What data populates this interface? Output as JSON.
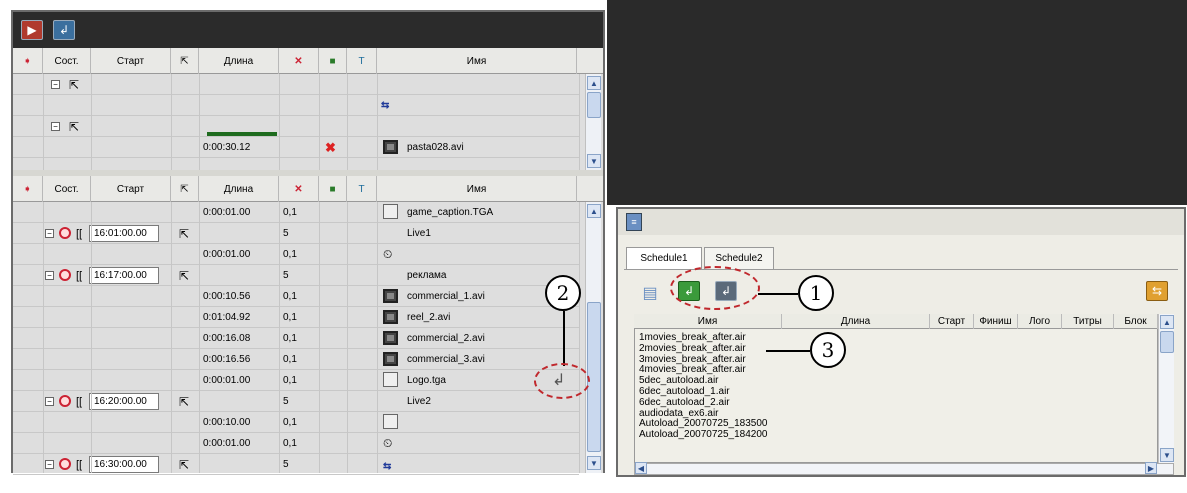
{
  "left_window": {
    "grid_headers": [
      "Сост.",
      "Старт",
      "Длина",
      "Имя"
    ],
    "top_grid": {
      "rows": [
        {
          "length": "",
          "name": ""
        },
        {
          "length": "",
          "name": ""
        },
        {
          "length": "",
          "name": ""
        },
        {
          "length": "0:00:30.12",
          "name": "pasta028.avi"
        }
      ]
    },
    "bottom_grid": {
      "rows": [
        {
          "start": "",
          "length": "0:00:01.00",
          "val": "0,1",
          "name": "game_caption.TGA"
        },
        {
          "start": "16:01:00.00",
          "length": "",
          "val": "5",
          "name": "Live1"
        },
        {
          "start": "",
          "length": "0:00:01.00",
          "val": "0,1",
          "name": ""
        },
        {
          "start": "16:17:00.00",
          "length": "",
          "val": "5",
          "name": "реклама"
        },
        {
          "start": "",
          "length": "0:00:10.56",
          "val": "0,1",
          "name": "commercial_1.avi"
        },
        {
          "start": "",
          "length": "0:01:04.92",
          "val": "0,1",
          "name": "reel_2.avi"
        },
        {
          "start": "",
          "length": "0:00:16.08",
          "val": "0,1",
          "name": "commercial_2.avi"
        },
        {
          "start": "",
          "length": "0:00:16.56",
          "val": "0,1",
          "name": "commercial_3.avi"
        },
        {
          "start": "",
          "length": "0:00:01.00",
          "val": "0,1",
          "name": "Logo.tga"
        },
        {
          "start": "16:20:00.00",
          "length": "",
          "val": "5",
          "name": "Live2"
        },
        {
          "start": "",
          "length": "0:00:10.00",
          "val": "0,1",
          "name": ""
        },
        {
          "start": "",
          "length": "0:00:01.00",
          "val": "0,1",
          "name": ""
        },
        {
          "start": "16:30:00.00",
          "length": "",
          "val": "5",
          "name": ""
        }
      ]
    }
  },
  "right_window": {
    "tabs": [
      "Schedule1",
      "Schedule2"
    ],
    "list_headers": [
      "Имя",
      "Длина",
      "Старт",
      "Финиш",
      "Лого",
      "Титры",
      "Блок"
    ],
    "items": [
      "1movies_break_after.air",
      "2movies_break_after.air",
      "3movies_break_after.air",
      "4movies_break_after.air",
      "5dec_autoload.air",
      "6dec_autoload_1.air",
      "6dec_autoload_2.air",
      "audiodata_ex6.air",
      "Autoload_20070725_183500",
      "Autoload_20070725_184200"
    ]
  },
  "callouts": [
    "1",
    "2",
    "3"
  ],
  "colors": {
    "dark": "#2a2a2a",
    "panel": "#d7d7d2",
    "accent_red": "#c0282d"
  }
}
